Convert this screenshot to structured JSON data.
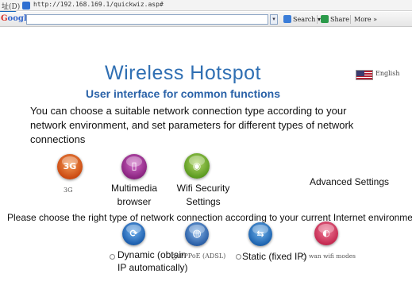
{
  "browser": {
    "address_label": "址(D)",
    "url": "http://192.168.169.1/quickwiz.asp#",
    "google_logo_prefix": "",
    "google_logo": "oogle",
    "dropdown_glyph": "▾",
    "search_label": "Search ▾",
    "share_label": "Share",
    "more_label": "More »"
  },
  "header": {
    "title": "Wireless Hotspot",
    "language": "English",
    "subtitle": "User interface for common functions"
  },
  "intro": {
    "text": "You can choose a suitable network connection type according to your network environment, and set parameters for different types of network connections"
  },
  "functions": [
    {
      "name": "3G",
      "icon": "3g-icon",
      "glyph": "3G"
    },
    {
      "name": "Multimedia browser",
      "icon": "multimedia-icon",
      "glyph": "▯"
    },
    {
      "name": "Wifi Security Settings",
      "icon": "wifi-security-icon",
      "glyph": "◉"
    },
    {
      "name": "Advanced Settings",
      "icon": "advanced-settings-icon",
      "glyph": "⚙"
    }
  ],
  "connection": {
    "prompt": "Please choose the right type of network connection according to your current Internet environment",
    "options": [
      {
        "label": "Dynamic (obtain IP automatically)",
        "icon": "dynamic-ip-icon",
        "glyph": "⟳"
      },
      {
        "label": "PPPoE (ADSL)",
        "icon": "pppoe-globe-icon",
        "glyph": "◍"
      },
      {
        "label": "Static (fixed IP)",
        "icon": "static-ip-icon",
        "glyph": "⇆"
      },
      {
        "label": "wan wifi modes",
        "icon": "wan-wifi-icon",
        "glyph": "◐"
      }
    ]
  },
  "colors": {
    "title": "#2f6fb3",
    "subtitle": "#2a62a8"
  }
}
